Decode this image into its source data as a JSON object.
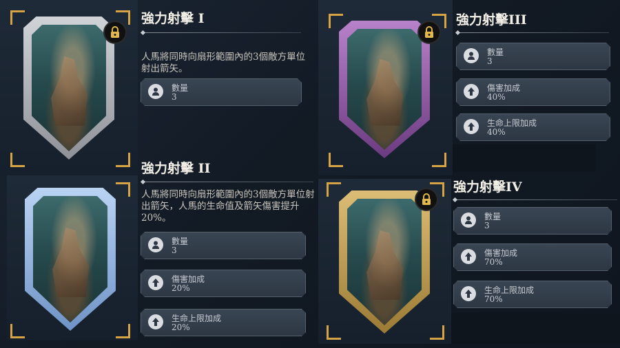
{
  "cards": [
    {
      "title": "強力射擊 I",
      "locked": true,
      "frame": "silver",
      "description": "人馬將同時向扇形範圍內的3個敵方單位射出箭矢。",
      "stats": [
        {
          "icon": "count-icon",
          "label": "數量",
          "value": "3"
        }
      ]
    },
    {
      "title": "強力射擊 II",
      "locked": false,
      "frame": "blue",
      "description": "人馬將同時向扇形範圍內的3個敵方單位射出箭矢，人馬的生命值及箭矢傷害提升20%。",
      "stats": [
        {
          "icon": "count-icon",
          "label": "數量",
          "value": "3"
        },
        {
          "icon": "damage-up-icon",
          "label": "傷害加成",
          "value": "20%"
        },
        {
          "icon": "hp-up-icon",
          "label": "生命上限加成",
          "value": "20%"
        }
      ]
    },
    {
      "title": "強力射擊III",
      "locked": true,
      "frame": "purple",
      "description": "",
      "stats": [
        {
          "icon": "count-icon",
          "label": "數量",
          "value": "3"
        },
        {
          "icon": "damage-up-icon",
          "label": "傷害加成",
          "value": "40%"
        },
        {
          "icon": "hp-up-icon",
          "label": "生命上限加成",
          "value": "40%"
        }
      ]
    },
    {
      "title": "強力射擊IV",
      "locked": true,
      "frame": "gold",
      "description": "",
      "stats": [
        {
          "icon": "count-icon",
          "label": "數量",
          "value": "3"
        },
        {
          "icon": "damage-up-icon",
          "label": "傷害加成",
          "value": "70%"
        },
        {
          "icon": "hp-up-icon",
          "label": "生命上限加成",
          "value": "70%"
        }
      ]
    }
  ],
  "colors": {
    "accent": "#d6a445",
    "silver": "#b8bcc2",
    "blue": "#8fb4e4",
    "purple": "#9a5cb0",
    "gold": "#c9a458"
  }
}
